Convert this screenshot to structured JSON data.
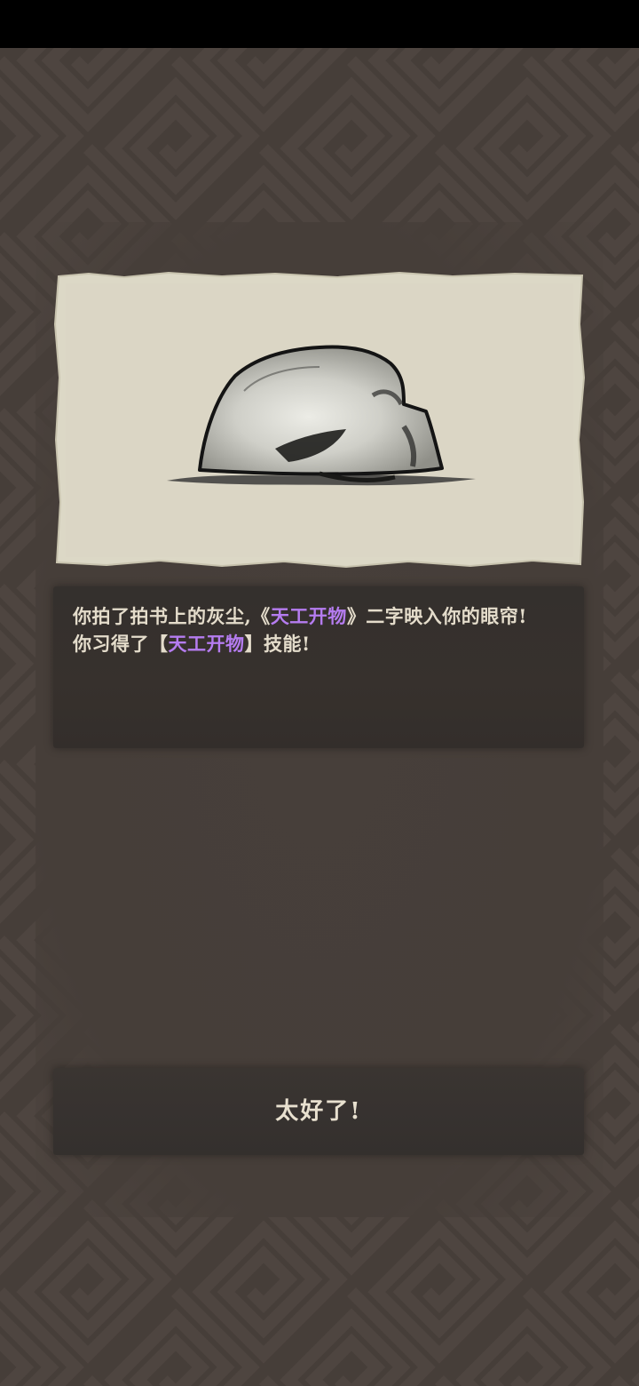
{
  "message": {
    "line1_prefix": "你拍了拍书上的灰尘,《",
    "line1_highlight": "天工开物",
    "line1_suffix": "》二字映入你的眼帘!",
    "line2_prefix": "你习得了【",
    "line2_highlight": "天工开物",
    "line2_suffix": "】技能!"
  },
  "confirm_button": {
    "label": "太好了!"
  },
  "colors": {
    "background": "#463e39",
    "panel": "#36312d",
    "text": "#e4dccb",
    "highlight": "#b57cf0",
    "paper": "#dcd8c6"
  },
  "illustration": {
    "subject": "ink-wash-rock"
  }
}
